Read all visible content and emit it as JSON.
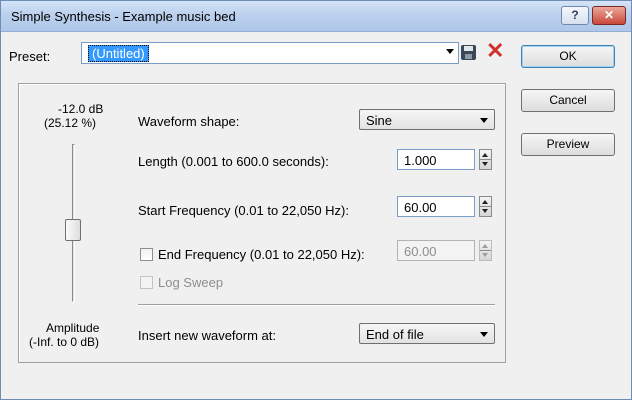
{
  "window": {
    "title": "Simple Synthesis - Example music bed",
    "help_button": "?",
    "close_button": "✕"
  },
  "preset": {
    "label": "Preset:",
    "value": "(Untitled)",
    "save_icon": "save-icon",
    "delete_icon": "delete-icon",
    "delete_glyph": "✕"
  },
  "buttons": {
    "ok": "OK",
    "cancel": "Cancel",
    "preview": "Preview"
  },
  "amplitude": {
    "db_value": "-12.0 dB",
    "percent_value": "(25.12 %)",
    "label": "Amplitude",
    "range": "(-Inf. to 0 dB)",
    "slider_level": 0.45
  },
  "waveform": {
    "label": "Waveform shape:",
    "value": "Sine"
  },
  "length": {
    "label": "Length (0.001 to 600.0 seconds):",
    "value": "1.000"
  },
  "start_freq": {
    "label": "Start Frequency (0.01 to 22,050 Hz):",
    "value": "60.00"
  },
  "end_freq": {
    "label": "End Frequency (0.01 to 22,050 Hz):",
    "value": "60.00",
    "checked": false,
    "enabled": true
  },
  "log_sweep": {
    "label": "Log Sweep",
    "checked": false,
    "enabled": false
  },
  "insert": {
    "label": "Insert new waveform at:",
    "value": "End of file"
  }
}
